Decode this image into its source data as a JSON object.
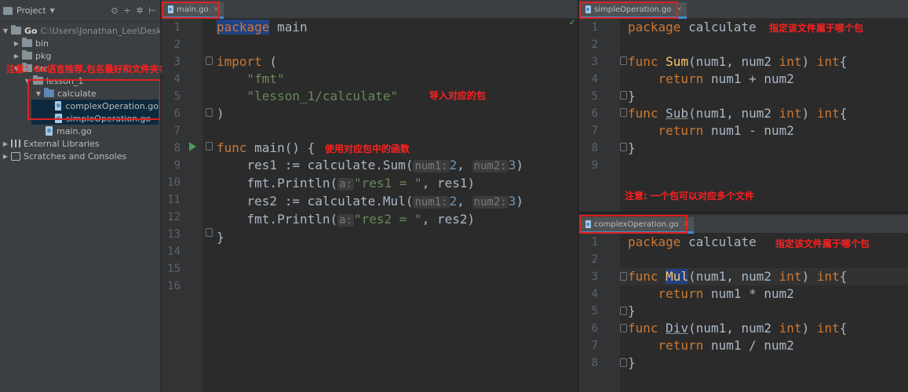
{
  "project": {
    "title": "Project",
    "tree": {
      "root": "Go",
      "root_path": "C:\\Users\\Jonathan_Lee\\Desktop\\Go",
      "bin": "bin",
      "pkg": "pkg",
      "src": "src",
      "lesson": "lesson_1",
      "calculate": "calculate",
      "complex": "complexOperation.go",
      "simple": "simpleOperation.go",
      "main": "main.go",
      "external": "External Libraries",
      "scratches": "Scratches and Consoles"
    }
  },
  "tabs": {
    "main": "main.go",
    "simple": "simpleOperation.go",
    "complex": "complexOperation.go"
  },
  "annotations": {
    "go_note": "注意：Go语言推荐,包名最好和文件夹名称一致",
    "import_note": "导入对应的包",
    "func_note": "使用对应包中的函数",
    "simple_pkg_note": "指定该文件属于哪个包",
    "multi_file_note": "注意: 一个包可以对应多个文件",
    "complex_pkg_note": "指定该文件属于哪个包"
  },
  "main_code": {
    "line_numbers": [
      "1",
      "2",
      "3",
      "4",
      "5",
      "6",
      "7",
      "8",
      "9",
      "10",
      "11",
      "12",
      "13",
      "14",
      "15",
      "16"
    ],
    "package_kw": "package",
    "package_name": " main",
    "import_kw": "import",
    "import_open": " (",
    "import_fmt": "\"fmt\"",
    "import_calc": "\"lesson_1/calculate\"",
    "import_close": ")",
    "func_kw": "func",
    "func_sig": " main() {",
    "res1_pre": "res1 := calculate.Sum(",
    "hint_num1": "num1:",
    "arg2": "2",
    "comma": ",",
    "hint_num2": "num2:",
    "arg3": "3",
    "close_paren": ")",
    "println_pre": "fmt.Println(",
    "hint_a": "a:",
    "str_res1": "\"res1 = \"",
    "println1_post": ", res1)",
    "res2_pre": "res2 := calculate.Mul(",
    "str_res2": "\"res2 = \"",
    "println2_post": ", res2)",
    "close_brace": "}"
  },
  "simple_code": {
    "line_numbers": [
      "1",
      "2",
      "3",
      "4",
      "5",
      "6",
      "7",
      "8",
      "9"
    ],
    "package_kw": "package",
    "package_name": " calculate",
    "func_kw": "func",
    "sum_name": "Sum",
    "sub_name": "Sub",
    "params_open": "(num1, num2 ",
    "int_type": "int",
    "params_close": ") ",
    "brace_open": "{",
    "return_kw": "return",
    "sum_expr": " num1 + num2",
    "sub_expr": " num1 - num2",
    "close_brace": "}"
  },
  "complex_code": {
    "line_numbers": [
      "1",
      "2",
      "3",
      "4",
      "5",
      "6",
      "7",
      "8"
    ],
    "package_kw": "package",
    "package_name": " calculate",
    "func_kw": "func",
    "mul_name": "Mul",
    "div_name": "Div",
    "params_open": "(num1, num2 ",
    "int_type": "int",
    "params_close": ") ",
    "brace_open": "{",
    "return_kw": "return",
    "mul_expr": " num1 * num2",
    "div_expr": " num1 / num2",
    "close_brace": "}"
  },
  "icons": {
    "tool_target": "⊙",
    "tool_split": "÷",
    "tool_gear": "✲",
    "tool_pin": "⊢",
    "arrow_down": "▼",
    "arrow_right": "▶",
    "close": "×",
    "check": "✓",
    "caret": "▼"
  },
  "colors": {
    "background": "#2b2b2b",
    "keyword": "#cc7832",
    "string": "#6a8759",
    "number": "#6897bb",
    "annotation": "#ff2020",
    "highlight_box": "#e02020"
  }
}
